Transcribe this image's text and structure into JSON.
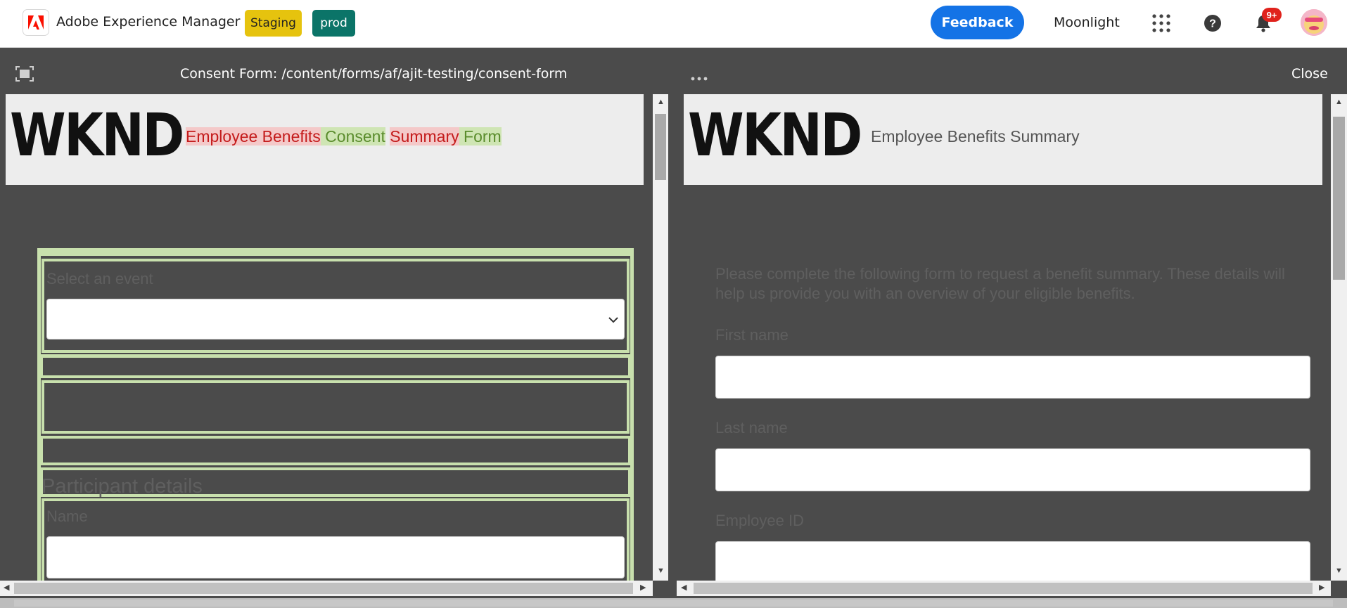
{
  "app": {
    "title": "Adobe Experience Manager",
    "env_staging": "Staging",
    "env_prod": "prod",
    "feedback": "Feedback",
    "org": "Moonlight",
    "notification_count": "9+",
    "icons": [
      "adobe-logo",
      "apps-grid-icon",
      "help-icon",
      "bell-icon",
      "avatar"
    ]
  },
  "panel": {
    "title": "Consent Form: /content/forms/af/ajit-testing/consent-form",
    "close": "Close"
  },
  "left": {
    "logo": "WKND",
    "title_segments": [
      {
        "text": "Employee Benefits",
        "change": "removed"
      },
      {
        "text": " Consent",
        "change": "added"
      },
      {
        "text": " ",
        "change": "none"
      },
      {
        "text": "Summary",
        "change": "removed"
      },
      {
        "text": " Form",
        "change": "added"
      }
    ],
    "select_label": "Select an event",
    "section_heading": "Participant details",
    "name_label": "Name"
  },
  "right": {
    "logo": "WKND",
    "title": "Employee Benefits Summary",
    "intro": "Please complete the following form to request a benefit summary. These details will help us provide you with an overview of your eligible benefits.",
    "fields": [
      "First name",
      "Last name",
      "Employee ID"
    ]
  },
  "colors": {
    "accent": "#1473e6",
    "staging": "#e6c30e",
    "prod": "#0b7468",
    "diff_added": "#c8e0ad",
    "diff_removed": "#f4c9c9",
    "canvas": "#4b4b4b"
  }
}
